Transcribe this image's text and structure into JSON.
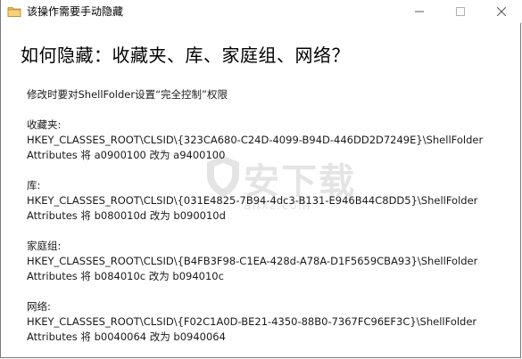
{
  "window": {
    "title": "该操作需要手动隐藏",
    "controls": {
      "minimize": "minimize",
      "maximize": "maximize",
      "close": "close"
    }
  },
  "heading": "如何隐藏：收藏夹、库、家庭组、网络？",
  "intro": "修改时要对ShellFolder设置“完全控制”权限",
  "sections": [
    {
      "label": "收藏夹:",
      "key": "HKEY_CLASSES_ROOT\\CLSID\\{323CA680-C24D-4099-B94D-446DD2D7249E}\\ShellFolder",
      "attributes": "Attributes 将 a0900100 改为 a9400100"
    },
    {
      "label": "库:",
      "key": "HKEY_CLASSES_ROOT\\CLSID\\{031E4825-7B94-4dc3-B131-E946B44C8DD5}\\ShellFolder",
      "attributes": "Attributes 将 b080010d 改为 b090010d"
    },
    {
      "label": "家庭组:",
      "key": "HKEY_CLASSES_ROOT\\CLSID\\{B4FB3F98-C1EA-428d-A78A-D1F5659CBA93}\\ShellFolder",
      "attributes": "Attributes 将 b084010c 改为 b094010c"
    },
    {
      "label": "网络:",
      "key": "HKEY_CLASSES_ROOT\\CLSID\\{F02C1A0D-BE21-4350-88B0-7367FC96EF3C}\\ShellFolder",
      "attributes": "Attributes 将 b0040064 改为 b0940064"
    }
  ],
  "watermark": {
    "text": "安下载",
    "subtext": "anxz.com"
  },
  "colors": {
    "folder_icon": "#e8b84a",
    "text": "#000000",
    "controls": "#555555"
  }
}
